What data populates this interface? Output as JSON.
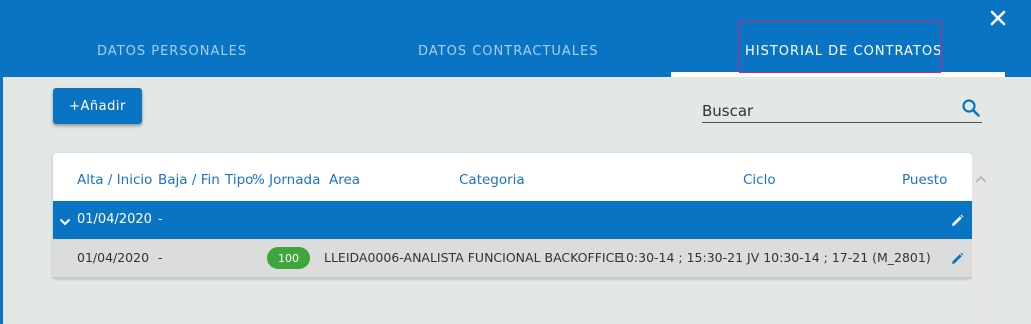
{
  "tabs": [
    {
      "label": "DATOS PERSONALES",
      "active": false
    },
    {
      "label": "DATOS CONTRACTUALES",
      "active": false
    },
    {
      "label": "HISTORIAL DE CONTRATOS",
      "active": true
    }
  ],
  "toolbar": {
    "add_label": "+Añadir"
  },
  "search": {
    "placeholder": "Buscar"
  },
  "table": {
    "headers": [
      "Alta / Inicio",
      "Baja / Fin",
      "Tipo",
      "% Jornada",
      "Area",
      "Categoria",
      "Ciclo",
      "Puesto"
    ],
    "group": {
      "alta": "01/04/2020",
      "baja": "-"
    },
    "rows": [
      {
        "alta": "01/04/2020",
        "baja": "-",
        "jornada": "100",
        "area_categoria": "LLEIDA0006-ANALISTA FUNCIONAL BACKOFFICE",
        "ciclo": "10:30-14 ; 15:30-21 JV 10:30-14 ; 17-21 (M_2801)"
      }
    ]
  },
  "colors": {
    "primary": "#0a74c4",
    "badge": "#3ea63b",
    "highlight": "#d0237e",
    "background": "#e3e8e4"
  },
  "icons": {
    "close": "close-icon",
    "search": "search-icon",
    "expand": "chevron-down-icon",
    "edit": "pencil-icon"
  }
}
